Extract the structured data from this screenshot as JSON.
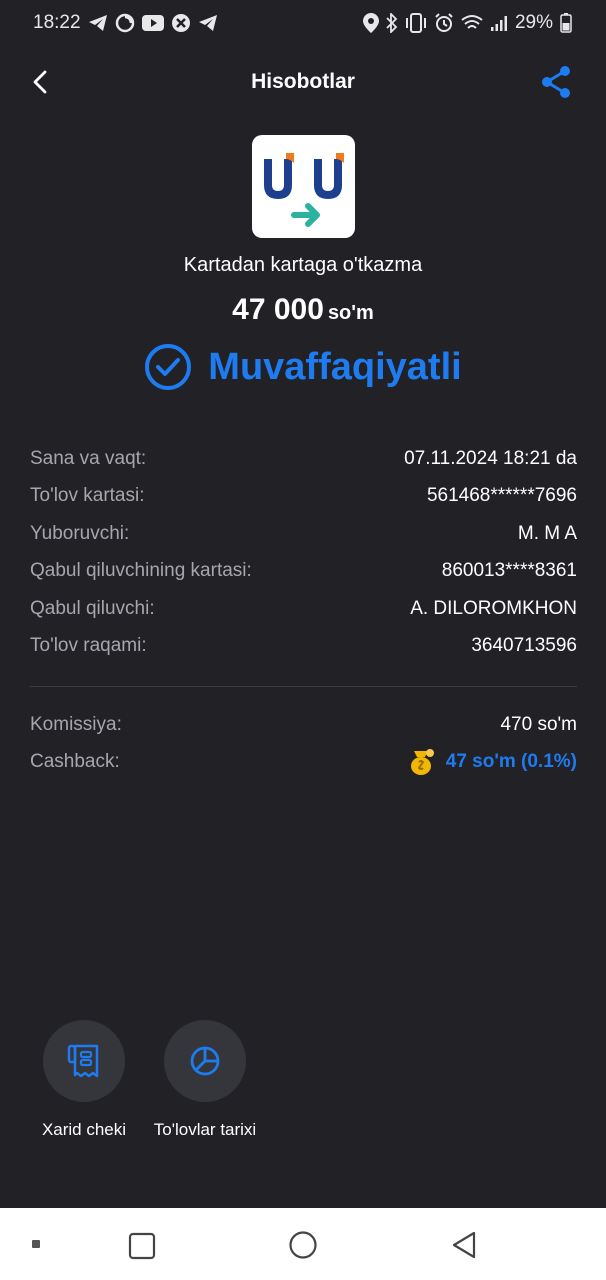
{
  "status_bar": {
    "time": "18:22",
    "battery": "29%",
    "icons_left": [
      "telegram-icon",
      "loading-icon",
      "youtube-icon",
      "app-icon",
      "telegram-icon"
    ],
    "icons_right": [
      "location-icon",
      "bluetooth-icon",
      "vibrate-icon",
      "alarm-icon",
      "wifi-icon",
      "signal-icon",
      "battery-icon"
    ]
  },
  "header": {
    "title": "Hisobotlar"
  },
  "transaction": {
    "name": "Kartadan kartaga o'tkazma",
    "amount": "47 000",
    "currency": "so'm",
    "status": "Muvaffaqiyatli"
  },
  "details": [
    {
      "label": "Sana va vaqt:",
      "value": "07.11.2024 18:21 da"
    },
    {
      "label": "To'lov kartasi:",
      "value": "561468******7696"
    },
    {
      "label": "Yuboruvchi:",
      "value": "M. M A"
    },
    {
      "label": "Qabul qiluvchining kartasi:",
      "value": "860013****8361"
    },
    {
      "label": "Qabul qiluvchi:",
      "value": "A. DILOROMKHON"
    },
    {
      "label": "To'lov raqami:",
      "value": "3640713596"
    }
  ],
  "fees": {
    "commission_label": "Komissiya:",
    "commission_value": "470 so'm",
    "cashback_label": "Cashback:",
    "cashback_value": "47 so'm (0.1%)"
  },
  "actions": [
    {
      "label": "Xarid cheki",
      "icon": "receipt-icon"
    },
    {
      "label": "To'lovlar tarixi",
      "icon": "pie-chart-icon"
    }
  ],
  "colors": {
    "background": "#212126",
    "accent": "#1e7cf0",
    "label": "#a6a6ad"
  }
}
